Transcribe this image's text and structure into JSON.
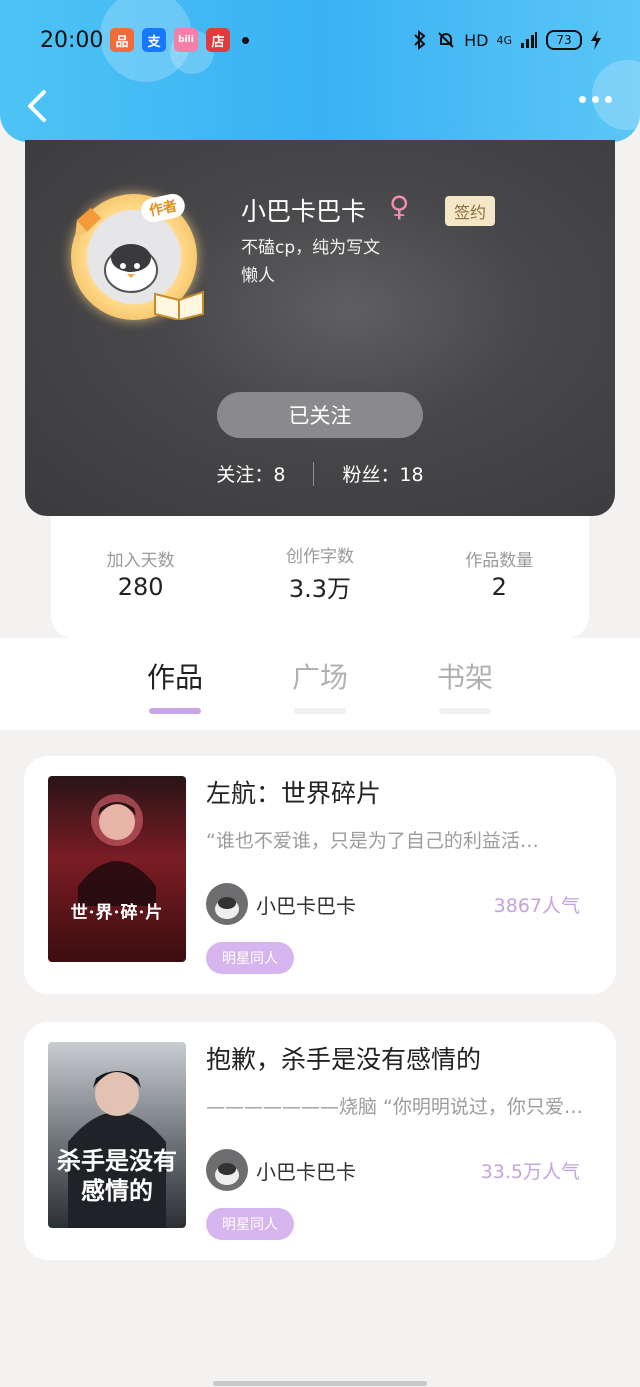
{
  "status_bar": {
    "time": "20:00",
    "app_icons": [
      {
        "name": "taobao-icon",
        "glyph": "品",
        "color": "#f26b3a"
      },
      {
        "name": "alipay-icon",
        "glyph": "支",
        "color": "#1677ff"
      },
      {
        "name": "bilibili-icon",
        "glyph": "bili",
        "color": "#f47fa8"
      },
      {
        "name": "shop-icon",
        "glyph": "店",
        "color": "#e23b3b"
      }
    ],
    "network": "HD",
    "signal": "4G",
    "battery": "73"
  },
  "header": {
    "back_icon": "chevron-left-icon",
    "more_icon": "more-dots-icon"
  },
  "profile": {
    "author_badge": "作者",
    "username": "小巴卡巴卡",
    "gender_symbol": "♀",
    "sign_badge": "签约",
    "bio_line1": "不磕cp，纯为写文",
    "bio_line2": "懒人",
    "follow_button": "已关注",
    "following_label": "关注：8",
    "fans_label": "粉丝：18"
  },
  "info": [
    {
      "label": "加入天数",
      "value": "280"
    },
    {
      "label": "创作字数",
      "value": "3.3万"
    },
    {
      "label": "作品数量",
      "value": "2"
    }
  ],
  "tabs": [
    {
      "label": "作品",
      "active": true
    },
    {
      "label": "广场",
      "active": false
    },
    {
      "label": "书架",
      "active": false
    }
  ],
  "books": [
    {
      "title": "左航：世界碎片",
      "excerpt": "“谁也不爱谁，只是为了自己的利益活…",
      "author": "小巴卡巴卡",
      "popularity": "3867人气",
      "tag": "明星同人",
      "cover_text": "世·界·碎·片"
    },
    {
      "title": "抱歉，杀手是没有感情的",
      "excerpt": "———————烧脑 “你明明说过，你只爱…",
      "author": "小巴卡巴卡",
      "popularity": "33.5万人气",
      "tag": "明星同人",
      "cover_text": "杀手是没有感情的"
    }
  ]
}
